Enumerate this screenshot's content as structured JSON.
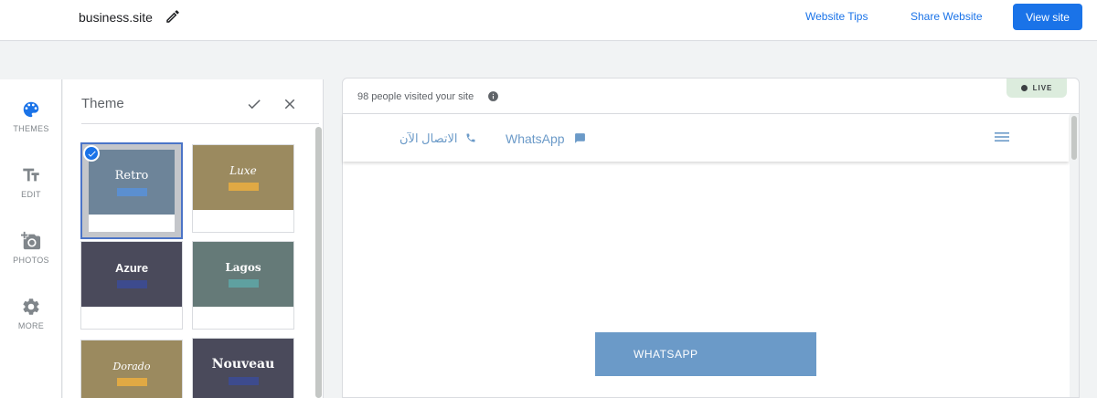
{
  "topbar": {
    "site_name": "business.site",
    "website_tips": "Website Tips",
    "share_website": "Share Website",
    "view_site": "View site"
  },
  "rail": {
    "items": [
      {
        "label": "THEMES",
        "icon": "palette-icon",
        "active": true
      },
      {
        "label": "EDIT",
        "icon": "text-format-icon"
      },
      {
        "label": "PHOTOS",
        "icon": "add-photo-icon"
      },
      {
        "label": "MORE",
        "icon": "gear-icon"
      }
    ]
  },
  "panel": {
    "title": "Theme",
    "themes": [
      {
        "name": "Retro",
        "bg": "#6d8499",
        "bar": "#5b8fd0",
        "selected": true
      },
      {
        "name": "Luxe",
        "bg": "#9b8a5f",
        "bar": "#e0a944"
      },
      {
        "name": "Azure",
        "bg": "#4a4a5b",
        "bar": "#3d4b8e"
      },
      {
        "name": "Lagos",
        "bg": "#657a78",
        "bar": "#5fa0a0"
      },
      {
        "name": "Dorado",
        "bg": "#9b8a5f",
        "bar": "#e0a944"
      },
      {
        "name": "Nouveau",
        "bg": "#4a4a5b",
        "bar": "#3d4b8e"
      }
    ]
  },
  "preview": {
    "visits": "98 people visited your site",
    "live": "LIVE",
    "call_now": "الاتصال الآن",
    "whatsapp": "WhatsApp",
    "whatsapp_button": "WHATSAPP"
  },
  "colors": {
    "accent": "#1a73e8",
    "site_accent": "#6b9ac8",
    "live_bg": "#dcecdd"
  }
}
